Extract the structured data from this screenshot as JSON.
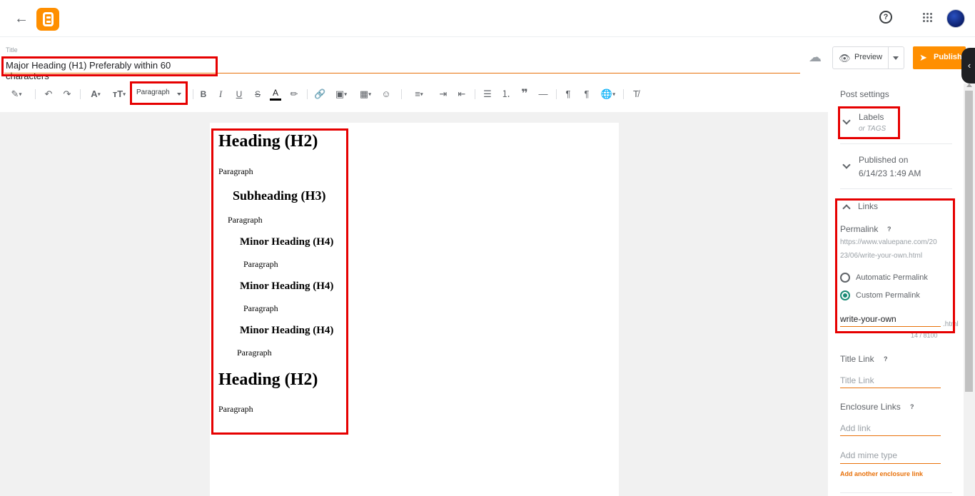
{
  "header": {
    "back_icon": "arrow-left-icon",
    "logo_icon": "blogger-logo-icon",
    "help_icon": "help-circle-icon",
    "apps_icon": "apps-grid-icon",
    "avatar_icon": "user-avatar"
  },
  "title": {
    "label": "Title",
    "value": "Major Heading (H1) Preferably within 60 characters"
  },
  "actions": {
    "preview_label": "Preview",
    "publish_label": "Publish"
  },
  "toolbar": {
    "paragraph_select": "Paragraph",
    "icons": [
      "pen-icon",
      "undo-icon",
      "redo-icon",
      "font-icon",
      "text-size-icon",
      "bold-icon",
      "italic-icon",
      "underline-icon",
      "strikethrough-icon",
      "text-color-icon",
      "highlight-icon",
      "link-icon",
      "image-icon",
      "video-icon",
      "emoji-icon",
      "align-icon",
      "indent-icon",
      "outdent-icon",
      "bullet-list-icon",
      "numbered-list-icon",
      "quote-icon",
      "horizontal-rule-icon",
      "ltr-icon",
      "rtl-icon",
      "language-icon",
      "clear-format-icon"
    ]
  },
  "document": {
    "blocks": [
      {
        "type": "h2",
        "text": "Heading (H2)"
      },
      {
        "type": "p",
        "text": "Paragraph"
      },
      {
        "type": "h3",
        "text": "Subheading (H3)"
      },
      {
        "type": "p",
        "text": "Paragraph"
      },
      {
        "type": "h4",
        "text": "Minor Heading (H4)"
      },
      {
        "type": "p",
        "text": "Paragraph"
      },
      {
        "type": "h4",
        "text": "Minor Heading (H4)"
      },
      {
        "type": "p",
        "text": "Paragraph"
      },
      {
        "type": "h4",
        "text": "Minor Heading (H4)"
      },
      {
        "type": "p",
        "text": "Paragraph"
      },
      {
        "type": "h2",
        "text": "Heading (H2)"
      },
      {
        "type": "p",
        "text": "Paragraph"
      }
    ]
  },
  "sidebar": {
    "title": "Post settings",
    "labels": {
      "title": "Labels",
      "sub": "or TAGS"
    },
    "published": {
      "title": "Published on",
      "value": "6/14/23 1:49 AM"
    },
    "links": {
      "title": "Links",
      "permalink_label": "Permalink",
      "permalink_url_line1": "https://www.valuepane.com/20",
      "permalink_url_line2": "23/06/write-your-own.html",
      "automatic": "Automatic Permalink",
      "custom": "Custom Permalink",
      "custom_value": "write-your-own",
      "suffix": ".html",
      "counter": "14 / 8100"
    },
    "title_link": {
      "label": "Title Link",
      "placeholder": "Title Link"
    },
    "enclosure": {
      "label": "Enclosure Links",
      "link_placeholder": "Add link",
      "mime_placeholder": "Add mime type",
      "add_another": "Add another enclosure link"
    },
    "help_mark": "?"
  },
  "colors": {
    "accent": "#ff8f00",
    "underline": "#e8710a",
    "annotation": "#e60000",
    "radio_on": "#1a8b75"
  }
}
